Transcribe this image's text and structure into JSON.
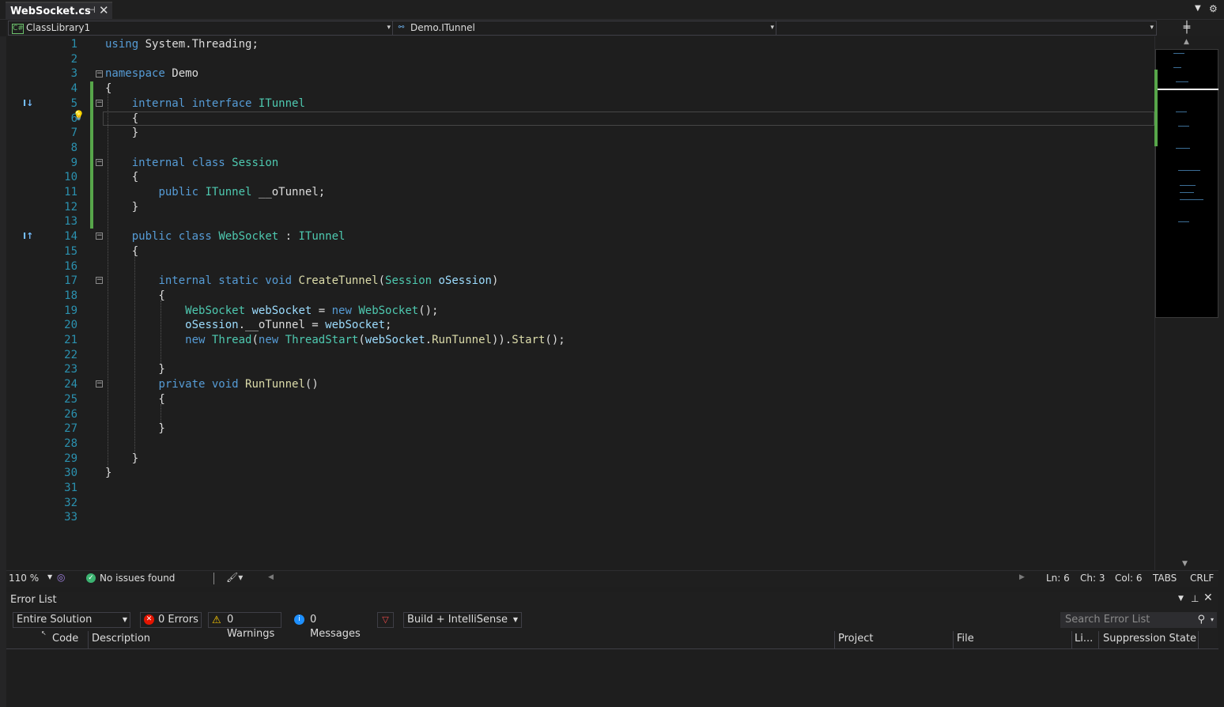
{
  "tab": {
    "title": "WebSocket.cs",
    "pin_glyph": "⊣",
    "close_glyph": "✕"
  },
  "navbar": {
    "project": "ClassLibrary1",
    "type": "Demo.ITunnel",
    "member": ""
  },
  "editor": {
    "line_numbers": [
      "1",
      "2",
      "3",
      "4",
      "5",
      "6",
      "7",
      "8",
      "9",
      "10",
      "11",
      "12",
      "13",
      "14",
      "15",
      "16",
      "17",
      "18",
      "19",
      "20",
      "21",
      "22",
      "23",
      "24",
      "25",
      "26",
      "27",
      "28",
      "29",
      "30",
      "31",
      "32",
      "33"
    ],
    "lines": [
      [
        {
          "c": "kw",
          "t": "using"
        },
        {
          "c": "pu",
          "t": " System.Threading;"
        }
      ],
      [],
      [
        {
          "c": "kw",
          "t": "namespace"
        },
        {
          "c": "pu",
          "t": " Demo"
        }
      ],
      [
        {
          "c": "pu",
          "t": "{"
        }
      ],
      [
        {
          "c": "pu",
          "t": "    "
        },
        {
          "c": "kw",
          "t": "internal interface"
        },
        {
          "c": "pu",
          "t": " "
        },
        {
          "c": "ty",
          "t": "ITunnel"
        }
      ],
      [
        {
          "c": "pu",
          "t": "    {"
        }
      ],
      [
        {
          "c": "pu",
          "t": "    }"
        }
      ],
      [],
      [
        {
          "c": "pu",
          "t": "    "
        },
        {
          "c": "kw",
          "t": "internal class"
        },
        {
          "c": "pu",
          "t": " "
        },
        {
          "c": "ty",
          "t": "Session"
        }
      ],
      [
        {
          "c": "pu",
          "t": "    {"
        }
      ],
      [
        {
          "c": "pu",
          "t": "        "
        },
        {
          "c": "kw",
          "t": "public"
        },
        {
          "c": "pu",
          "t": " "
        },
        {
          "c": "ty",
          "t": "ITunnel"
        },
        {
          "c": "pu",
          "t": " __oTunnel;"
        }
      ],
      [
        {
          "c": "pu",
          "t": "    }"
        }
      ],
      [],
      [
        {
          "c": "pu",
          "t": "    "
        },
        {
          "c": "kw",
          "t": "public class"
        },
        {
          "c": "pu",
          "t": " "
        },
        {
          "c": "ty",
          "t": "WebSocket"
        },
        {
          "c": "pu",
          "t": " : "
        },
        {
          "c": "ty",
          "t": "ITunnel"
        }
      ],
      [
        {
          "c": "pu",
          "t": "    {"
        }
      ],
      [],
      [
        {
          "c": "pu",
          "t": "        "
        },
        {
          "c": "kw",
          "t": "internal static void"
        },
        {
          "c": "pu",
          "t": " "
        },
        {
          "c": "mt",
          "t": "CreateTunnel"
        },
        {
          "c": "pu",
          "t": "("
        },
        {
          "c": "ty",
          "t": "Session"
        },
        {
          "c": "pu",
          "t": " "
        },
        {
          "c": "pm",
          "t": "oSession"
        },
        {
          "c": "pu",
          "t": ")"
        }
      ],
      [
        {
          "c": "pu",
          "t": "        {"
        }
      ],
      [
        {
          "c": "pu",
          "t": "            "
        },
        {
          "c": "ty",
          "t": "WebSocket"
        },
        {
          "c": "pu",
          "t": " "
        },
        {
          "c": "pm",
          "t": "webSocket"
        },
        {
          "c": "pu",
          "t": " = "
        },
        {
          "c": "kw",
          "t": "new"
        },
        {
          "c": "pu",
          "t": " "
        },
        {
          "c": "ty",
          "t": "WebSocket"
        },
        {
          "c": "pu",
          "t": "();"
        }
      ],
      [
        {
          "c": "pu",
          "t": "            "
        },
        {
          "c": "pm",
          "t": "oSession"
        },
        {
          "c": "pu",
          "t": ".__oTunnel = "
        },
        {
          "c": "pm",
          "t": "webSocket"
        },
        {
          "c": "pu",
          "t": ";"
        }
      ],
      [
        {
          "c": "pu",
          "t": "            "
        },
        {
          "c": "kw",
          "t": "new"
        },
        {
          "c": "pu",
          "t": " "
        },
        {
          "c": "ty",
          "t": "Thread"
        },
        {
          "c": "pu",
          "t": "("
        },
        {
          "c": "kw",
          "t": "new"
        },
        {
          "c": "pu",
          "t": " "
        },
        {
          "c": "ty",
          "t": "ThreadStart"
        },
        {
          "c": "pu",
          "t": "("
        },
        {
          "c": "pm",
          "t": "webSocket"
        },
        {
          "c": "pu",
          "t": "."
        },
        {
          "c": "mt",
          "t": "RunTunnel"
        },
        {
          "c": "pu",
          "t": "))."
        },
        {
          "c": "mt",
          "t": "Start"
        },
        {
          "c": "pu",
          "t": "();"
        }
      ],
      [],
      [
        {
          "c": "pu",
          "t": "        }"
        }
      ],
      [
        {
          "c": "pu",
          "t": "        "
        },
        {
          "c": "kw",
          "t": "private void"
        },
        {
          "c": "pu",
          "t": " "
        },
        {
          "c": "mt",
          "t": "RunTunnel"
        },
        {
          "c": "pu",
          "t": "()"
        }
      ],
      [
        {
          "c": "pu",
          "t": "        {"
        }
      ],
      [],
      [
        {
          "c": "pu",
          "t": "        }"
        }
      ],
      [],
      [
        {
          "c": "pu",
          "t": "    }"
        }
      ],
      [
        {
          "c": "pu",
          "t": "}"
        }
      ],
      [],
      [],
      []
    ]
  },
  "status": {
    "zoom": "110 %",
    "issues": "No issues found",
    "ln": "Ln: 6",
    "ch": "Ch: 3",
    "col": "Col: 6",
    "tabs": "TABS",
    "eol": "CRLF"
  },
  "error_list": {
    "title": "Error List",
    "scope": "Entire Solution",
    "errors": "0 Errors",
    "warnings": "0 Warnings",
    "messages": "0 Messages",
    "build_filter": "Build + IntelliSense",
    "search_placeholder": "Search Error List",
    "columns": {
      "code": "Code",
      "description": "Description",
      "project": "Project",
      "file": "File",
      "line": "Li...",
      "suppression": "Suppression State"
    }
  },
  "colors": {
    "keyword": "#569cd6",
    "type": "#4ec9b0",
    "method": "#dcdcaa",
    "param": "#9cdcfe",
    "line_number": "#2b91af",
    "changed_bar": "#57a64a"
  }
}
